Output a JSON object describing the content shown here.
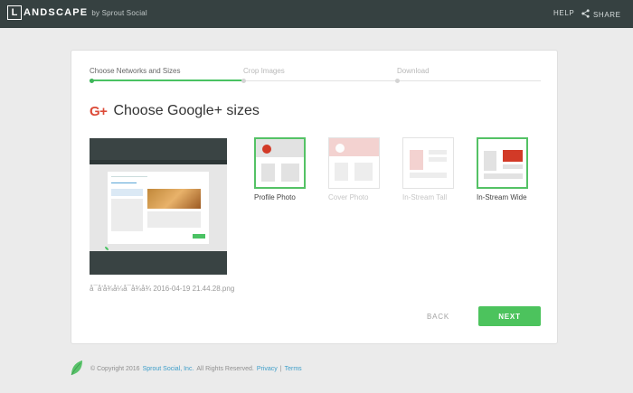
{
  "header": {
    "logo_letter": "L",
    "logo_text": "ANDSCAPE",
    "logo_by": "by Sprout Social",
    "help_label": "HELP",
    "share_label": "SHARE",
    "share_icon": "share-icon"
  },
  "steps": [
    {
      "label": "Choose Networks and Sizes",
      "state": "active"
    },
    {
      "label": "Crop Images",
      "state": "upcoming"
    },
    {
      "label": "Download",
      "state": "upcoming"
    }
  ],
  "heading": {
    "icon_text": "G+",
    "title": "Choose Google+ sizes"
  },
  "preview": {
    "filename": "å¯å'å¾å¼å¯å¾å¾ 2016-04-19 21.44.28.png"
  },
  "options": [
    {
      "label": "Profile Photo",
      "state": "selected"
    },
    {
      "label": "Cover Photo",
      "state": "disabled"
    },
    {
      "label": "In-Stream Tall",
      "state": "disabled"
    },
    {
      "label": "In-Stream Wide",
      "state": "selected"
    }
  ],
  "buttons": {
    "back": "BACK",
    "next": "NEXT"
  },
  "footer": {
    "copyright": "© Copyright 2016",
    "company": "Sprout Social, Inc.",
    "rights": "All Rights Reserved.",
    "privacy": "Privacy",
    "separator": "|",
    "terms": "Terms"
  },
  "colors": {
    "accent_green": "#4cc35d",
    "topbar": "#364141",
    "google_red": "#dc4a38"
  }
}
